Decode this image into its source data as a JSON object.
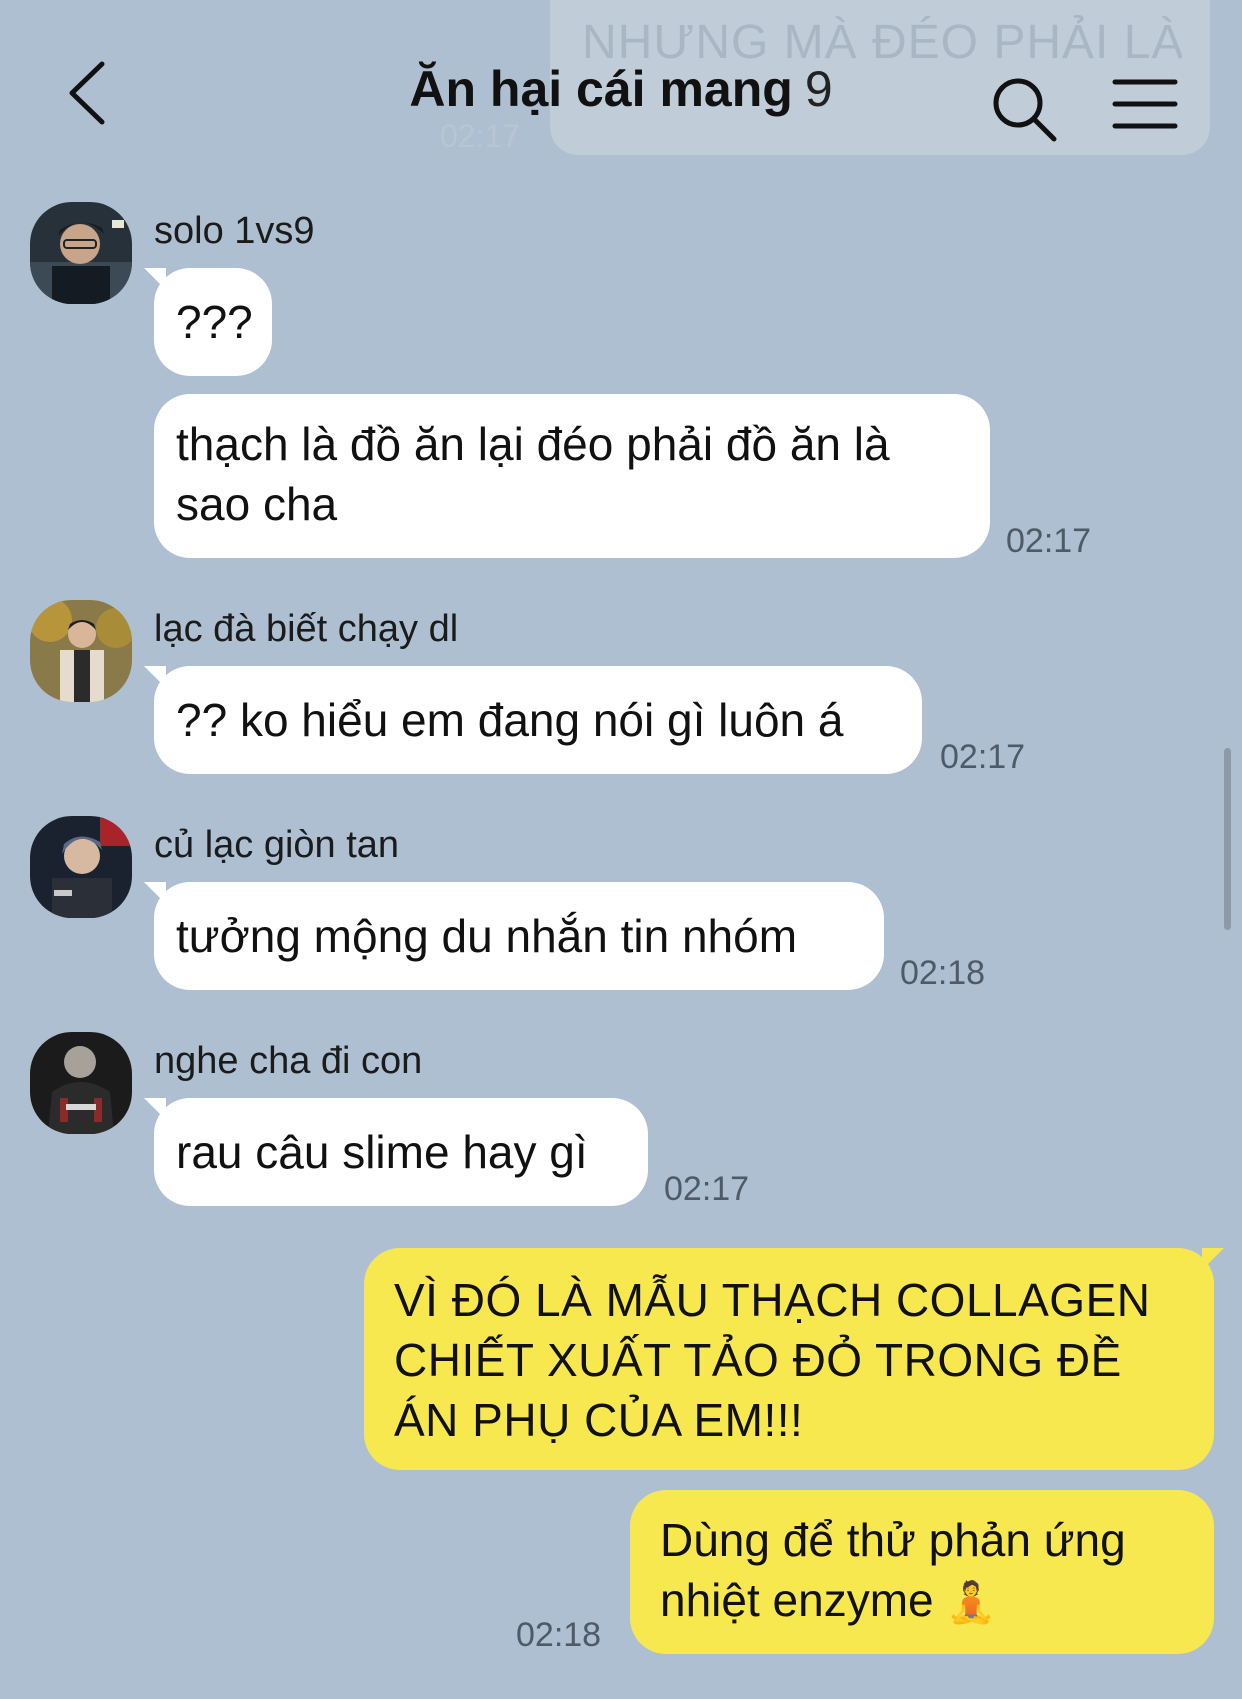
{
  "header": {
    "title": "Ăn hại cái mang",
    "member_count": "9",
    "ghost_message": "NHƯNG MÀ ĐÉO PHẢI LÀ ĐỒ ĂN...",
    "ghost_time": "02:17"
  },
  "messages": [
    {
      "sender": "solo 1vs9",
      "lines": [
        "???"
      ],
      "time": ""
    },
    {
      "sender": "",
      "lines": [
        "thạch là đồ ăn lại đéo phải đồ ăn là",
        "sao cha"
      ],
      "time": "02:17"
    },
    {
      "sender": "lạc đà biết chạy dl",
      "lines": [
        "?? ko hiểu em đang nói gì luôn á"
      ],
      "time": "02:17"
    },
    {
      "sender": "củ lạc giòn tan",
      "lines": [
        "tưởng mộng du nhắn tin nhóm"
      ],
      "time": "02:18"
    },
    {
      "sender": "nghe cha đi con",
      "lines": [
        "rau câu slime hay gì"
      ],
      "time": "02:17"
    },
    {
      "sender": "me",
      "lines": [
        "VÌ ĐÓ LÀ MẪU THẠCH COLLAGEN",
        "CHIẾT XUẤT TẢO ĐỎ TRONG ĐỀ",
        "ÁN PHỤ CỦA EM!!!"
      ],
      "time": ""
    },
    {
      "sender": "me",
      "lines": [
        "Dùng để thử phản ứng",
        "nhiệt enzyme"
      ],
      "emoji": "🧘",
      "time": "02:18"
    }
  ],
  "icons": {
    "back": "chevron-left-icon",
    "search": "search-icon",
    "menu": "hamburger-menu-icon"
  },
  "colors": {
    "background": "#aebfd1",
    "my_bubble": "#f8e84f",
    "their_bubble": "#ffffff"
  }
}
